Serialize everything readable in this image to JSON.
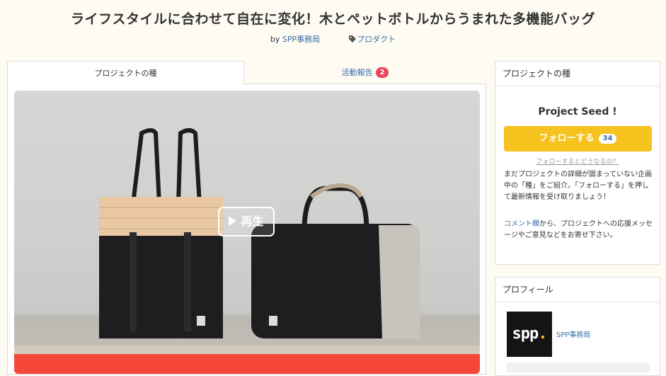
{
  "page": {
    "title": "ライフスタイルに合わせて自在に変化！木とペットボトルからうまれた多機能バッグ",
    "by_label": "by",
    "author": "SPP事務局",
    "category": "プロダクト"
  },
  "tabs": [
    {
      "label": "プロジェクトの種",
      "active": true
    },
    {
      "label": "活動報告",
      "badge": "2",
      "active": false
    }
  ],
  "hero": {
    "play_label": "再生"
  },
  "sidebar": {
    "seed_card": {
      "header": "プロジェクトの種",
      "title": "Project Seed !",
      "follow_label": "フォローする",
      "follow_count": "34",
      "follow_help": "フォローするとどうなるの？",
      "description": "まだプロジェクトの詳細が固まっていない企画中の「種」をご紹介。「フォローする」を押して最新情報を受け取りましょう！",
      "comment_link": "コメント欄",
      "comment_text": "から、プロジェクトへの応援メッセージやご意見などをお寄せ下さい。"
    },
    "profile_card": {
      "header": "プロフィール",
      "logo_text": "spp",
      "name": "SPP事務局"
    }
  },
  "colors": {
    "accent_yellow": "#f6c21d",
    "link_blue": "#3a6ea5",
    "badge_red": "#e8455a",
    "hero_strip_red": "#f4473a"
  }
}
